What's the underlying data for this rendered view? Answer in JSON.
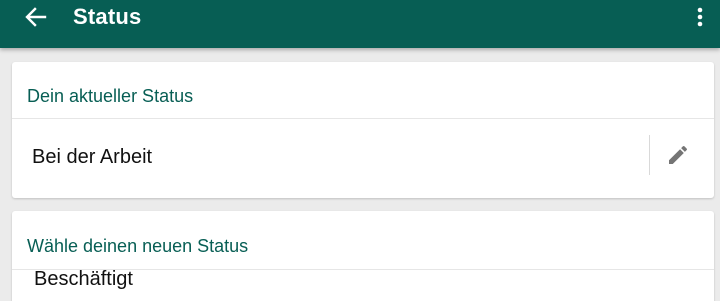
{
  "appbar": {
    "title": "Status",
    "color": "#075e54",
    "back_icon": "arrow-left-icon",
    "menu_icon": "more-vertical-icon"
  },
  "current_status": {
    "header": "Dein aktueller Status",
    "value": "Bei der Arbeit",
    "edit_icon": "pencil-icon"
  },
  "new_status": {
    "header": "Wähle deinen neuen Status",
    "options": [
      {
        "label": "Beschäftigt"
      }
    ]
  },
  "colors": {
    "accent": "#075e54",
    "background": "#ebebeb",
    "card": "#ffffff",
    "icon_gray": "#757575"
  }
}
